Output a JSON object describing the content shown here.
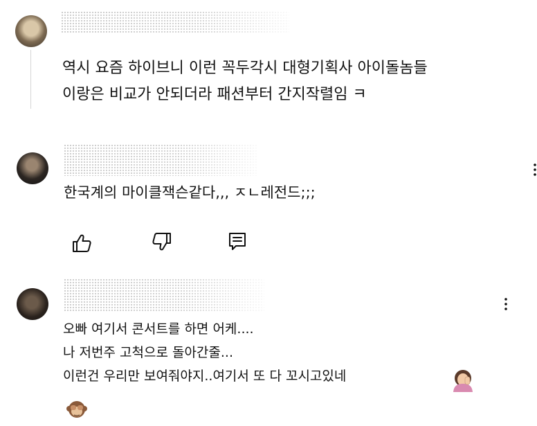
{
  "comments": [
    {
      "lines": [
        "역시 요즘 하이브니 이런 꼭두각시 대형기획사 아이돌놈들",
        "이랑은 비교가 안되더라 패션부터 간지작렬임 ㅋ"
      ]
    },
    {
      "lines": [
        "한국계의 마이클잭슨같다,,, ㅈㄴ레전드;;;"
      ]
    },
    {
      "lines": [
        "오빠 여기서 콘서트를 하면 어케....",
        "나 저번주 고척으로 돌아간줄...",
        "이런건 우리만 보여줘야지..여기서 또 다 꼬시고있네"
      ]
    }
  ],
  "icons": {
    "like": "thumbs-up-icon",
    "dislike": "thumbs-down-icon",
    "reply": "reply-icon",
    "more": "more-vertical-icon",
    "emoji_1": "woman-facepalming-emoji",
    "emoji_2": "see-no-evil-monkey-emoji"
  },
  "colors": {
    "text": "#0f0f0f",
    "icon": "#0f0f0f",
    "thread_line": "#d6d6d6"
  }
}
